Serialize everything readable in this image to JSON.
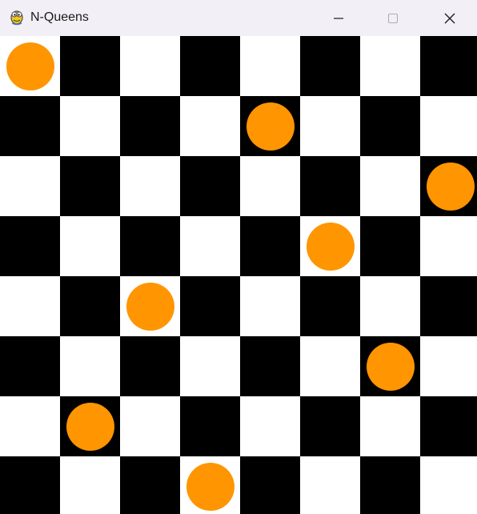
{
  "window": {
    "title": "N-Queens",
    "app_icon": "pygame-snake-icon",
    "controls": [
      "minimize-icon",
      "maximize-icon",
      "close-icon"
    ]
  },
  "board": {
    "size": 8,
    "colors": {
      "dark": "#000000",
      "light": "#ffffff",
      "queen": "#ff9500",
      "title_bar": "#f3eff6"
    },
    "queen_columns_by_row": [
      0,
      4,
      7,
      5,
      2,
      6,
      1,
      3
    ]
  }
}
